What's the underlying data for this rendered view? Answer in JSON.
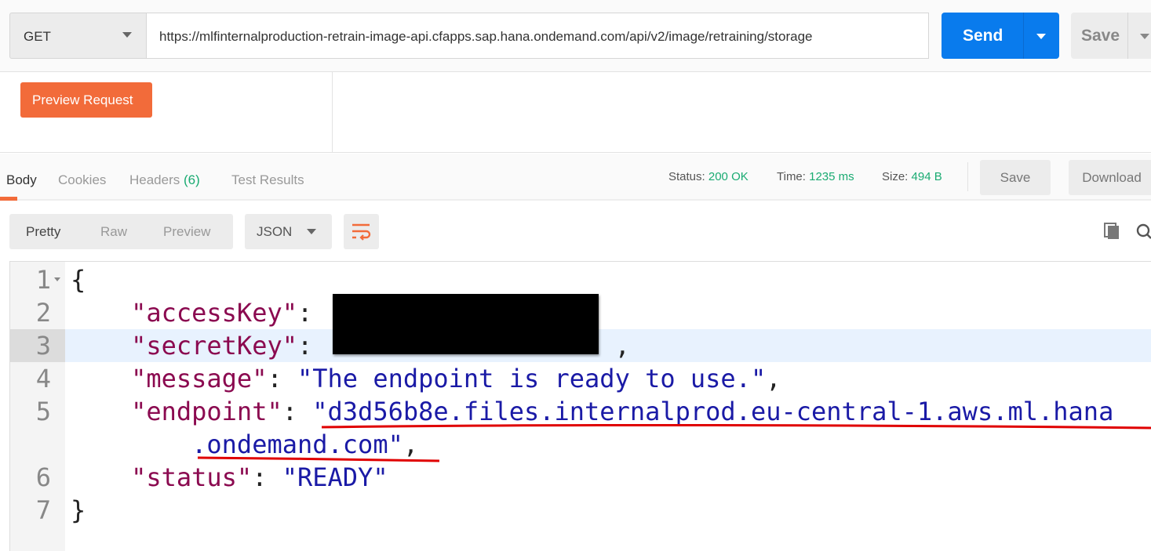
{
  "request": {
    "method": "GET",
    "url": "https://mlfinternalproduction-retrain-image-api.cfapps.sap.hana.ondemand.com/api/v2/image/retraining/storage",
    "send_label": "Send",
    "save_label": "Save",
    "preview_label": "Preview Request"
  },
  "response": {
    "tabs": [
      {
        "label": "Body",
        "active": true
      },
      {
        "label": "Cookies"
      },
      {
        "label": "Headers",
        "count": "(6)"
      },
      {
        "label": "Test Results"
      }
    ],
    "status_label": "Status:",
    "status": "200 OK",
    "time_label": "Time:",
    "time": "1235 ms",
    "size_label": "Size:",
    "size": "494 B",
    "save_label": "Save",
    "download_label": "Download",
    "formats": [
      "Pretty",
      "Raw",
      "Preview"
    ],
    "language": "JSON",
    "lines": [
      {
        "n": "1",
        "parts": [
          [
            "p",
            "{"
          ]
        ]
      },
      {
        "n": "2",
        "parts": [
          [
            "k",
            "    \"accessKey\""
          ],
          [
            "p",
            ": "
          ]
        ]
      },
      {
        "n": "3",
        "parts": [
          [
            "k",
            "    \"secretKey\""
          ],
          [
            "p",
            ":                    ,"
          ]
        ]
      },
      {
        "n": "4",
        "parts": [
          [
            "k",
            "    \"message\""
          ],
          [
            "p",
            ": "
          ],
          [
            "s",
            "\"The endpoint is ready to use.\""
          ],
          [
            "p",
            ","
          ]
        ]
      },
      {
        "n": "5",
        "parts": [
          [
            "k",
            "    \"endpoint\""
          ],
          [
            "p",
            ": "
          ],
          [
            "s",
            "\"d3d56b8e.files.internalprod.eu-central-1.aws.ml.hana"
          ]
        ]
      },
      {
        "n": "",
        "parts": [
          [
            "s",
            "        .ondemand.com\""
          ],
          [
            "p",
            ","
          ]
        ]
      },
      {
        "n": "6",
        "parts": [
          [
            "k",
            "    \"status\""
          ],
          [
            "p",
            ": "
          ],
          [
            "s",
            "\"READY\""
          ]
        ]
      },
      {
        "n": "7",
        "parts": [
          [
            "p",
            "}"
          ]
        ]
      }
    ]
  },
  "colors": {
    "send": "#097bed",
    "preview": "#f26b3a",
    "ok": "#1aab72",
    "key": "#8b0a50",
    "string": "#1a1aa6",
    "annotation": "#e00000"
  }
}
